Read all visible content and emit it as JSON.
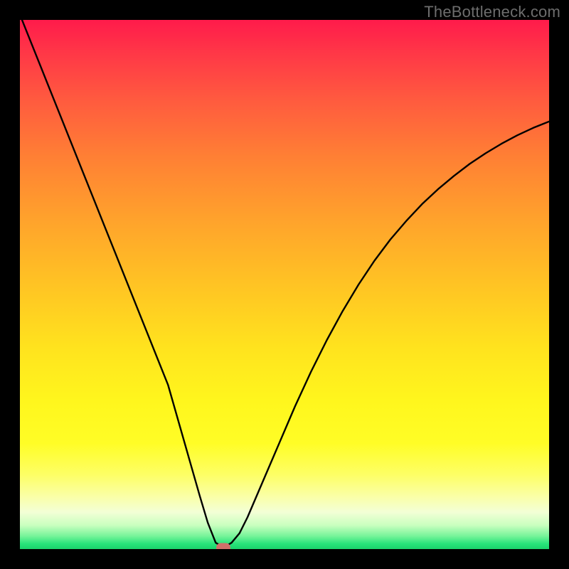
{
  "watermark": {
    "text": "TheBottleneck.com"
  },
  "colors": {
    "frame_bg": "#000000",
    "curve_stroke": "#000000",
    "marker_fill": "#d1706a",
    "watermark_fg": "#6d6d6d"
  },
  "chart_data": {
    "type": "line",
    "title": "",
    "xlabel": "",
    "ylabel": "",
    "xlim": [
      0,
      100
    ],
    "ylim": [
      0,
      100
    ],
    "grid": false,
    "legend": false,
    "series": [
      {
        "name": "bottleneck-curve",
        "x": [
          0,
          2,
          4,
          6,
          8,
          10,
          12,
          14,
          16,
          18,
          20,
          22,
          24,
          26,
          28,
          30,
          32,
          34,
          35.5,
          37,
          38.5,
          40,
          41.5,
          43,
          46,
          49,
          52,
          55,
          58,
          61,
          64,
          67,
          70,
          73,
          76,
          79,
          82,
          85,
          88,
          91,
          94,
          97,
          100
        ],
        "y": [
          101,
          96,
          91,
          86,
          81,
          76,
          71,
          66,
          61,
          56,
          51,
          46,
          41,
          36,
          31,
          24,
          17,
          10,
          5,
          1.2,
          0.3,
          1.2,
          3,
          6,
          13,
          20,
          27,
          33.5,
          39.5,
          45,
          50,
          54.5,
          58.5,
          62,
          65.2,
          68,
          70.5,
          72.8,
          74.8,
          76.6,
          78.2,
          79.6,
          80.8
        ]
      }
    ],
    "marker": {
      "x": 38.5,
      "y": 0.3
    }
  }
}
